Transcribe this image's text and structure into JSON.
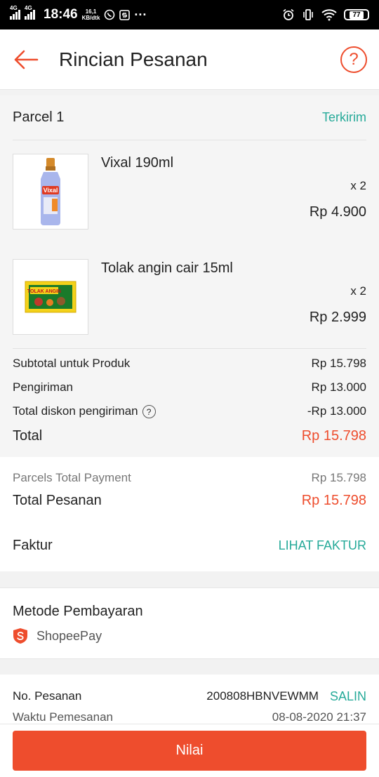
{
  "status_bar": {
    "network1": "4G",
    "network2": "4G",
    "time": "18:46",
    "speed_value": "16,1",
    "speed_unit": "KB/dtk",
    "more": "···",
    "battery": "77"
  },
  "header": {
    "title": "Rincian Pesanan",
    "help": "?"
  },
  "parcel": {
    "name": "Parcel 1",
    "status": "Terkirim",
    "items": [
      {
        "name": "Vixal 190ml",
        "qty": "x 2",
        "price": "Rp 4.900",
        "image": "vixal-bottle"
      },
      {
        "name": "Tolak angin cair 15ml",
        "qty": "x 2",
        "price": "Rp 2.999",
        "image": "tolak-angin-pack"
      }
    ],
    "summary": {
      "subtotal_label": "Subtotal untuk Produk",
      "subtotal_value": "Rp 15.798",
      "shipping_label": "Pengiriman",
      "shipping_value": "Rp 13.000",
      "discount_label": "Total diskon pengiriman",
      "discount_value": "-Rp 13.000",
      "total_label": "Total",
      "total_value": "Rp 15.798"
    }
  },
  "totals": {
    "parcels_label": "Parcels Total Payment",
    "parcels_value": "Rp 15.798",
    "order_label": "Total Pesanan",
    "order_value": "Rp 15.798",
    "invoice_label": "Faktur",
    "invoice_link": "LIHAT FAKTUR"
  },
  "payment": {
    "title": "Metode Pembayaran",
    "method": "ShopeePay"
  },
  "order_info": {
    "number_label": "No. Pesanan",
    "number_value": "200808HBNVEWMM",
    "copy_label": "SALIN",
    "time_label": "Waktu Pemesanan",
    "time_value": "08-08-2020 21:37"
  },
  "bottom": {
    "rate_label": "Nilai"
  },
  "colors": {
    "accent": "#ee4d2d",
    "teal": "#26aa99"
  }
}
